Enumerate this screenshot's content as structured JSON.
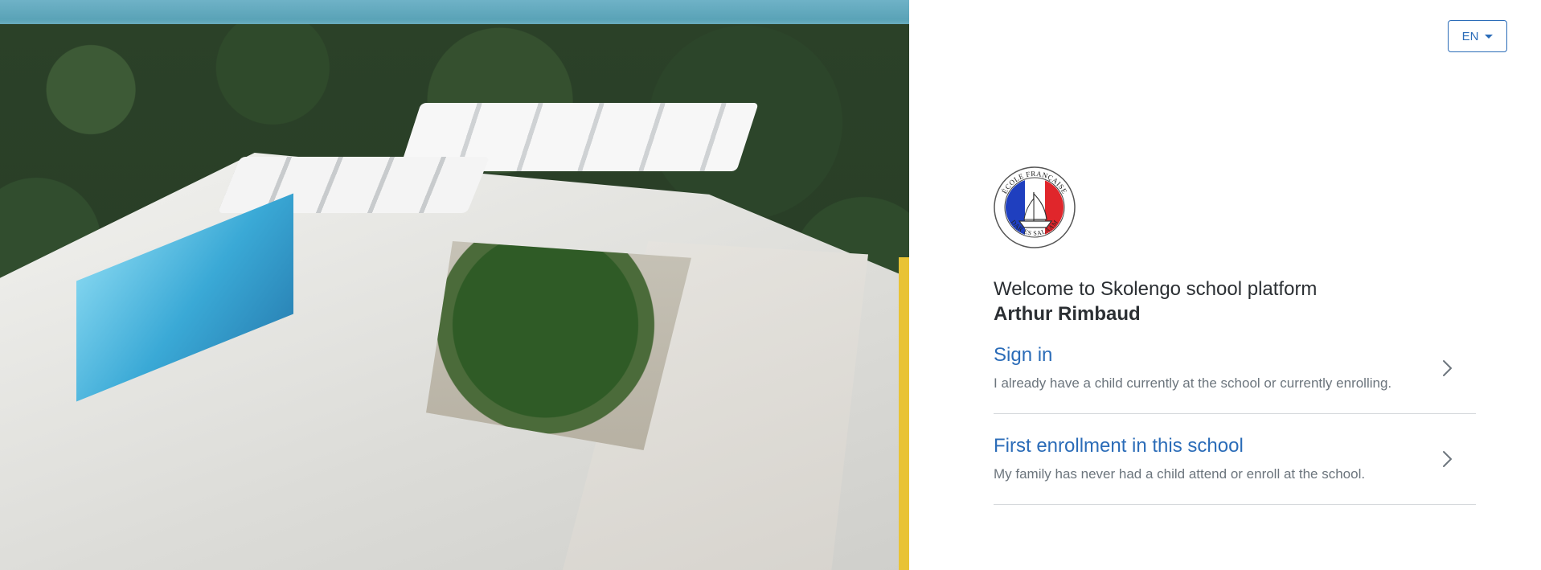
{
  "hero": {
    "image_alt": "Aerial photo of school campus"
  },
  "language": {
    "current": "EN",
    "icon": "caret-down-icon"
  },
  "logo": {
    "text_top": "ÉCOLE FRANÇAISE",
    "text_bottom": "DAR ES SALAAM",
    "colors": [
      "#1f3fbf",
      "#ffffff",
      "#e0262b"
    ]
  },
  "header": {
    "welcome": "Welcome to Skolengo school platform",
    "school_name": "Arthur Rimbaud"
  },
  "options": [
    {
      "title": "Sign in",
      "description": "I already have a child currently at the school or currently enrolling.",
      "icon": "chevron-right-icon"
    },
    {
      "title": "First enrollment in this school",
      "description": "My family has never had a child attend or enroll at the school.",
      "icon": "chevron-right-icon"
    }
  ],
  "colors": {
    "accent": "#2b6cb8",
    "muted": "#6c757d",
    "divider": "#d6d9dc"
  }
}
